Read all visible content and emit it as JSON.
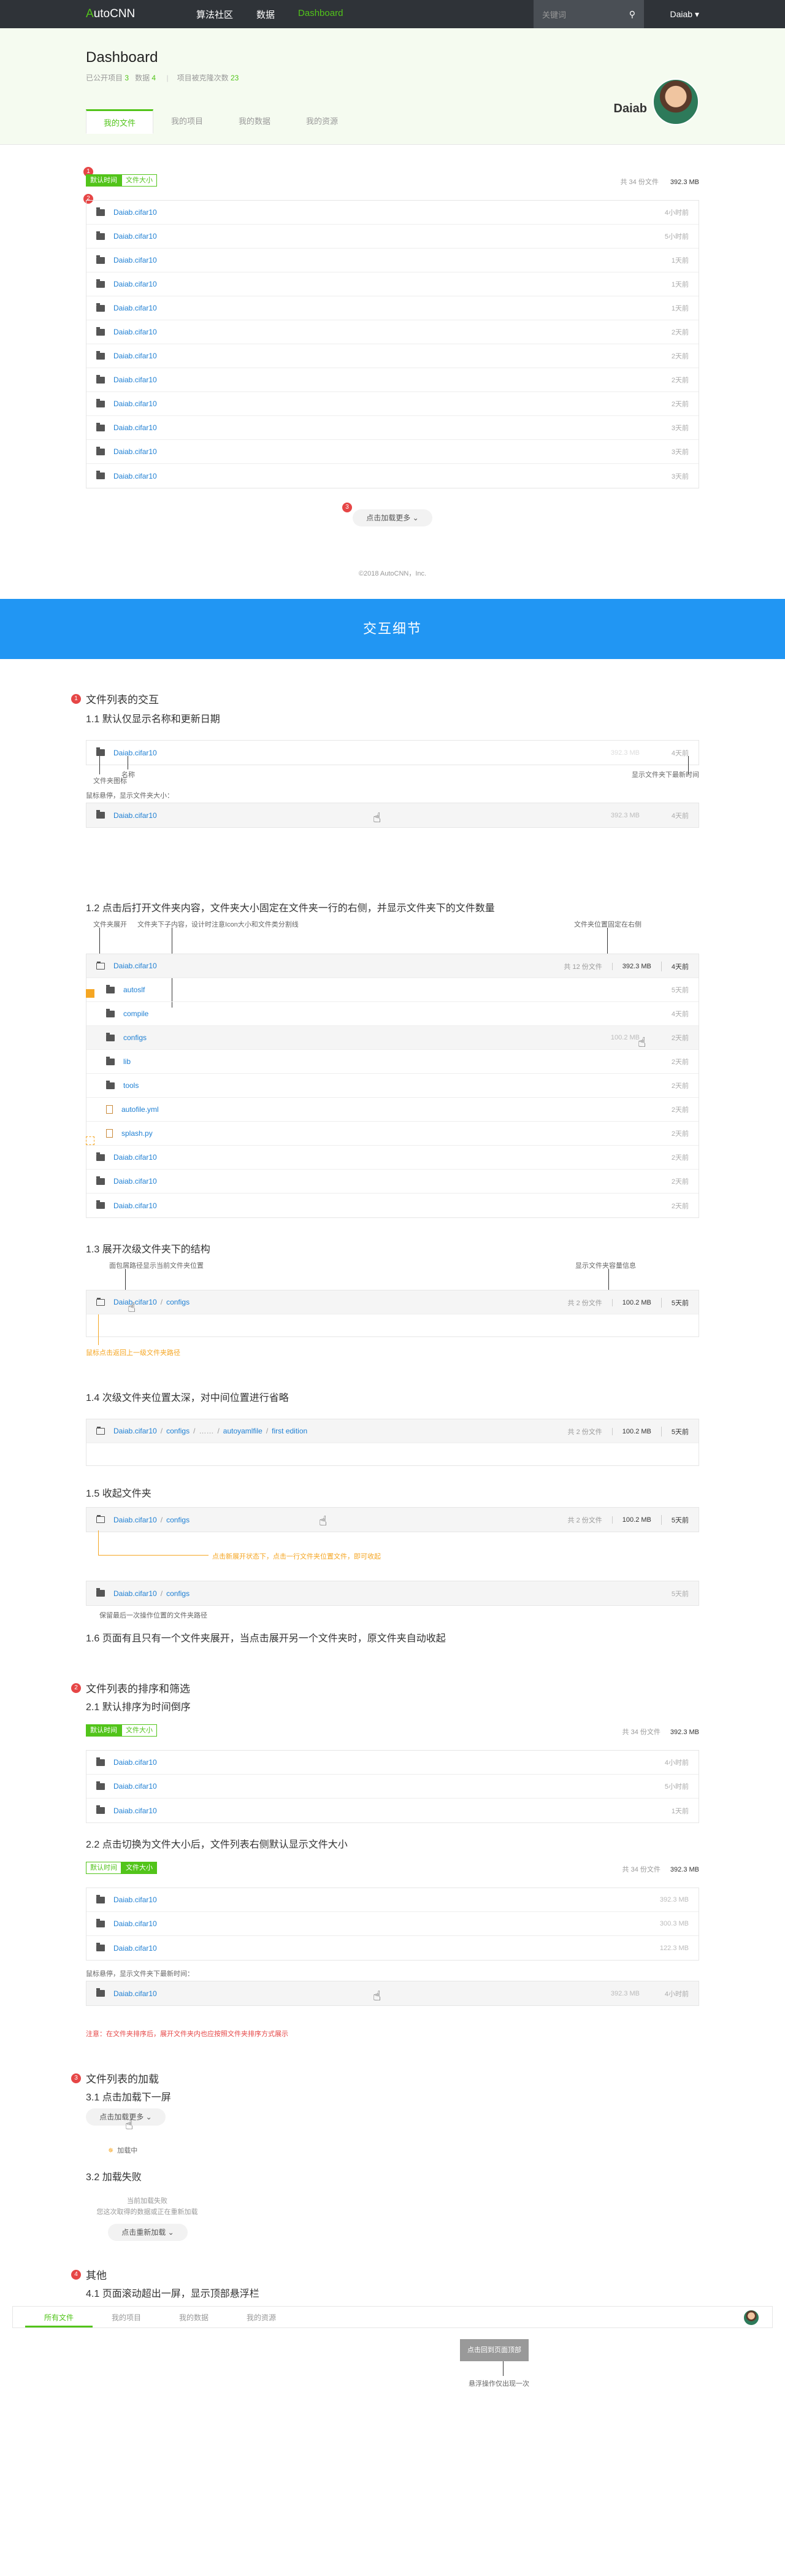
{
  "nav": {
    "logo_a": "A",
    "logo_rest": "utoCNN",
    "links": [
      "算法社区",
      "数据",
      "Dashboard"
    ],
    "search_placeholder": "关键词",
    "user": "Daiab ▾"
  },
  "header": {
    "title": "Dashboard",
    "stat1_label": "已公开项目",
    "stat1_value": "3",
    "stat2_label": "数据",
    "stat2_value": "4",
    "stat3_label": "项目被克隆次数",
    "stat3_value": "23",
    "tabs": [
      "我的文件",
      "我的项目",
      "我的数据",
      "我的资源"
    ],
    "username": "Daiab"
  },
  "files": {
    "toggle_date": "默认时间",
    "toggle_size": "文件大小",
    "count_prefix": "共",
    "count": "34",
    "count_suffix": "份文件",
    "total_size": "392.3 MB",
    "rows": [
      {
        "name": "Daiab.cifar10",
        "date": "4小时前"
      },
      {
        "name": "Daiab.cifar10",
        "date": "5小时前"
      },
      {
        "name": "Daiab.cifar10",
        "date": "1天前"
      },
      {
        "name": "Daiab.cifar10",
        "date": "1天前"
      },
      {
        "name": "Daiab.cifar10",
        "date": "1天前"
      },
      {
        "name": "Daiab.cifar10",
        "date": "2天前"
      },
      {
        "name": "Daiab.cifar10",
        "date": "2天前"
      },
      {
        "name": "Daiab.cifar10",
        "date": "2天前"
      },
      {
        "name": "Daiab.cifar10",
        "date": "2天前"
      },
      {
        "name": "Daiab.cifar10",
        "date": "3天前"
      },
      {
        "name": "Daiab.cifar10",
        "date": "3天前"
      },
      {
        "name": "Daiab.cifar10",
        "date": "3天前"
      }
    ],
    "load_more": "点击加载更多 ⌄",
    "copyright": "©2018 AutoCNN，Inc."
  },
  "banner": "交互细节",
  "sec1": {
    "title": "文件列表的交互",
    "s11": "1.1 默认仅显示名称和更新日期",
    "s11_row": {
      "name": "Daiab.cifar10",
      "size": "392.3 MB",
      "date": "4天前"
    },
    "s11_label_icon": "文件夹图标",
    "s11_label_name": "名称",
    "s11_label_date": "显示文件夹下最新时间",
    "s11_hover": "鼠标悬停，显示文件夹大小：",
    "s11_hover_row": {
      "name": "Daiab.cifar10",
      "size": "392.3 MB",
      "date": "4天前"
    },
    "s12": "1.2 点击后打开文件夹内容，文件夹大小固定在文件夹一行的右侧，并显示文件夹下的文件数量",
    "s12_note_a": "文件夹展开",
    "s12_note_b": "文件夹下子内容，设计时注意Icon大小和文件类分割线",
    "s12_note_c": "文件夹位置固定在右侧",
    "s12_header": {
      "name": "Daiab.cifar10",
      "count": "共 12 份文件",
      "size": "392.3 MB",
      "date": "4天前"
    },
    "s12_rows": [
      {
        "name": "autoslf",
        "date": "5天前",
        "type": "folder"
      },
      {
        "name": "compile",
        "date": "4天前",
        "type": "folder"
      },
      {
        "name": "configs",
        "size": "100.2 MB",
        "date": "2天前",
        "type": "folder"
      },
      {
        "name": "lib",
        "date": "2天前",
        "type": "folder"
      },
      {
        "name": "tools",
        "date": "2天前",
        "type": "folder"
      },
      {
        "name": "autofile.yml",
        "date": "2天前",
        "type": "doc"
      },
      {
        "name": "splash.py",
        "date": "2天前",
        "type": "doc"
      },
      {
        "name": "Daiab.cifar10",
        "date": "2天前",
        "type": "folder"
      },
      {
        "name": "Daiab.cifar10",
        "date": "2天前",
        "type": "folder"
      },
      {
        "name": "Daiab.cifar10",
        "date": "2天前",
        "type": "folder"
      }
    ],
    "s13": "1.3 展开次级文件夹下的结构",
    "s13_note_a": "面包屑路径显示当前文件夹位置",
    "s13_note_b": "显示文件夹容量信息",
    "s13_row": {
      "path1": "Daiab.cifar10",
      "path2": "configs",
      "count": "共 2 份文件",
      "size": "100.2 MB",
      "date": "5天前"
    },
    "s13_note_c": "鼠标点击返回上一级文件夹路径",
    "s14": "1.4 次级文件夹位置太深，对中间位置进行省略",
    "s14_row": {
      "path1": "Daiab.cifar10",
      "path2": "configs",
      "path3": "……",
      "path4": "autoyamlfile",
      "path5": "first edition",
      "count": "共 2 份文件",
      "size": "100.2 MB",
      "date": "5天前"
    },
    "s15": "1.5 收起文件夹",
    "s15_row": {
      "path1": "Daiab.cifar10",
      "path2": "configs",
      "count": "共 2 份文件",
      "size": "100.2 MB",
      "date": "5天前"
    },
    "s15_note_a": "点击新展开状态下，点击一行文件夹位置文件，即可收起",
    "s15_row2": {
      "path1": "Daiab.cifar10",
      "path2": "configs",
      "date": "5天前"
    },
    "s15_note_b": "保留最后一次操作位置的文件夹路径",
    "s16": "1.6 页面有且只有一个文件夹展开，当点击展开另一个文件夹时，原文件夹自动收起"
  },
  "sec2": {
    "title": "文件列表的排序和筛选",
    "s21": "2.1 默认排序为时间倒序",
    "toggle_date": "默认时间",
    "toggle_size": "文件大小",
    "count": "共 34 份文件",
    "total_size": "392.3 MB",
    "s21_rows": [
      {
        "name": "Daiab.cifar10",
        "date": "4小时前"
      },
      {
        "name": "Daiab.cifar10",
        "date": "5小时前"
      },
      {
        "name": "Daiab.cifar10",
        "date": "1天前"
      }
    ],
    "s22": "2.2 点击切换为文件大小后，文件列表右侧默认显示文件大小",
    "s22_rows": [
      {
        "name": "Daiab.cifar10",
        "size": "392.3 MB"
      },
      {
        "name": "Daiab.cifar10",
        "size": "300.3 MB"
      },
      {
        "name": "Daiab.cifar10",
        "size": "122.3 MB"
      }
    ],
    "s22_hover": "鼠标悬停，显示文件夹下最新时间：",
    "s22_hover_row": {
      "name": "Daiab.cifar10",
      "size": "392.3 MB",
      "date": "4小时前"
    },
    "s22_warn": "注意：在文件夹排序后，展开文件夹内也应按照文件夹排序方式展示"
  },
  "sec3": {
    "title": "文件列表的加载",
    "s31": "3.1 点击加载下一屏",
    "load_more": "点击加载更多 ⌄",
    "loading": "加载中",
    "s32": "3.2 加载失败",
    "fail1": "当前加载失败",
    "fail2": "您这次取得的数据或正在重新加载",
    "reload": "点击重新加载 ⌄"
  },
  "sec4": {
    "title": "其他",
    "s41": "4.1 页面滚动超出一屏，显示顶部悬浮栏",
    "tabs": [
      "所有文件",
      "我的项目",
      "我的数据",
      "我的资源"
    ],
    "tip": "点击回到页面顶部",
    "tip_note": "悬浮操作仅出现一次"
  }
}
